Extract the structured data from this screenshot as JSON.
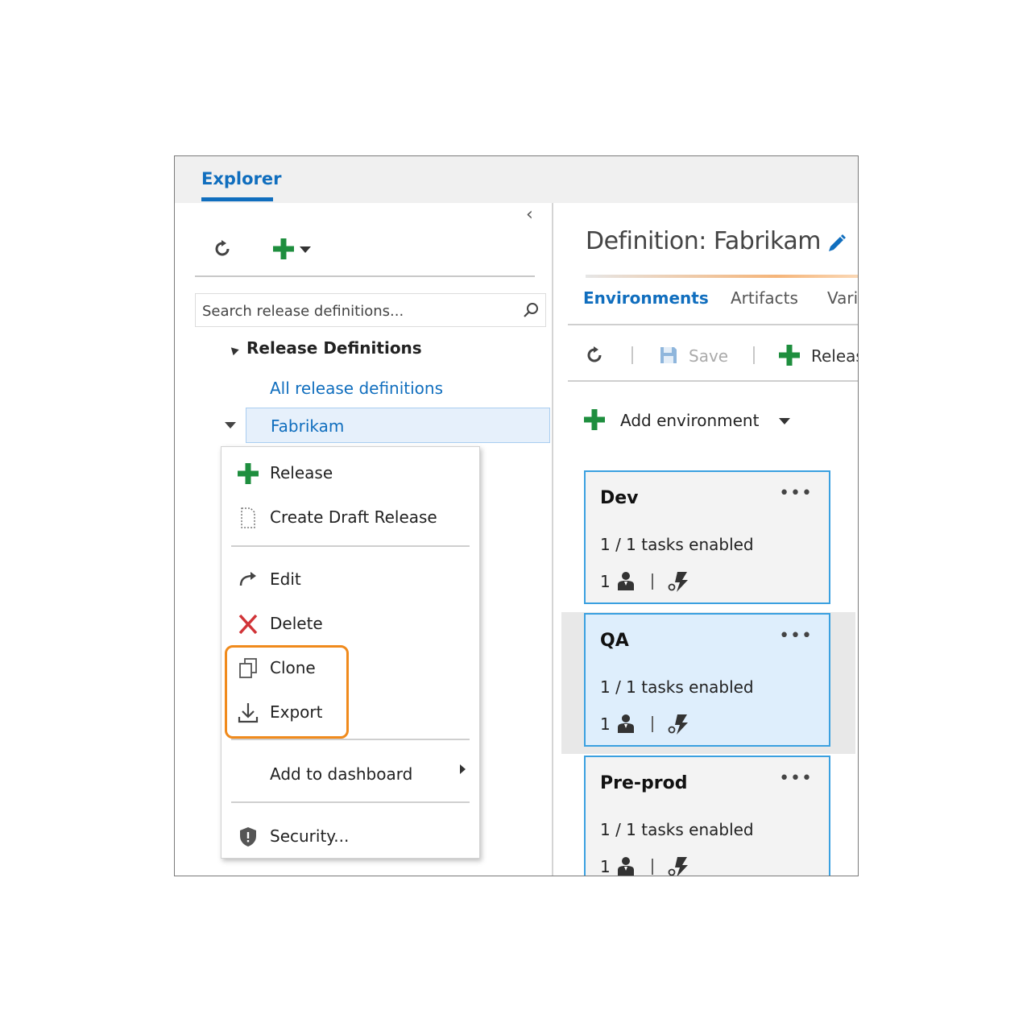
{
  "explorer_tab": "Explorer",
  "left_pane": {
    "search": {
      "placeholder": "Search release definitions..."
    },
    "tree": {
      "root_label": "Release Definitions",
      "all_label": "All release definitions",
      "selected_label": "Fabrikam"
    }
  },
  "context_menu": {
    "release": "Release",
    "create_draft": "Create Draft Release",
    "edit": "Edit",
    "delete": "Delete",
    "clone": "Clone",
    "export": "Export",
    "add_dashboard": "Add to dashboard",
    "security": "Security..."
  },
  "definition": {
    "title": "Definition: Fabrikam",
    "tabs": {
      "environments": "Environments",
      "artifacts": "Artifacts",
      "variables": "Vari"
    },
    "toolbar": {
      "save": "Save",
      "release": "Releas"
    },
    "add_environment": "Add environment"
  },
  "environments": [
    {
      "name": "Dev",
      "more": "•••",
      "tasks": "1 / 1 tasks enabled",
      "approvers": "1"
    },
    {
      "name": "QA",
      "more": "•••",
      "tasks": "1 / 1 tasks enabled",
      "approvers": "1"
    },
    {
      "name": "Pre-prod",
      "more": "•••",
      "tasks": "1 / 1 tasks enabled",
      "approvers": "1"
    }
  ],
  "colors": {
    "accent_blue": "#106ebe",
    "add_green": "#1e8e3e",
    "delete_red": "#d13438",
    "highlight_orange": "#f08a1c",
    "card_border": "#3aa0e0"
  }
}
